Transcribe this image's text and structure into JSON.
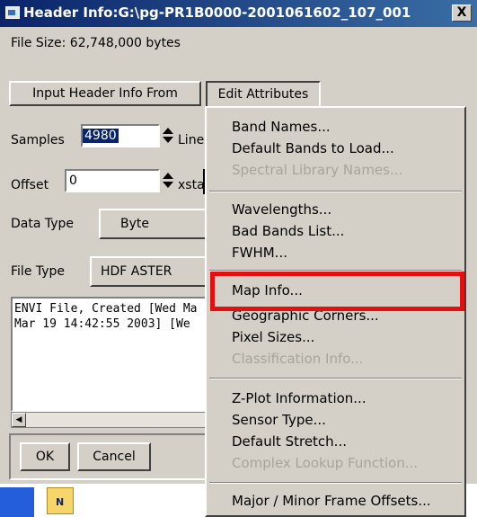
{
  "window": {
    "title": "Header Info:G:\\pg-PR1B0000-2001061602_107_001",
    "close_glyph": "X"
  },
  "file_size": "File Size: 62,748,000 bytes",
  "buttons": {
    "input_header": "Input Header Info From",
    "edit_attributes": "Edit Attributes",
    "ok": "OK",
    "cancel": "Cancel"
  },
  "fields": {
    "samples_label": "Samples",
    "samples_value": "4980",
    "lines_label": "Line",
    "offset_label": "Offset",
    "offset_value": "0",
    "xstart_label": "xstart",
    "data_type_label": "Data Type",
    "data_type_value": "Byte",
    "file_type_label": "File Type",
    "file_type_value": "HDF ASTER"
  },
  "description": {
    "line1": "ENVI File, Created [Wed Ma",
    "line2": "Mar 19 14:42:55 2003] [We"
  },
  "menu": {
    "groups": [
      [
        {
          "label": "Band Names...",
          "enabled": true
        },
        {
          "label": "Default Bands to Load...",
          "enabled": true
        },
        {
          "label": "Spectral Library Names...",
          "enabled": false
        }
      ],
      [
        {
          "label": "Wavelengths...",
          "enabled": true
        },
        {
          "label": "Bad Bands List...",
          "enabled": true
        },
        {
          "label": "FWHM...",
          "enabled": true
        }
      ],
      [
        {
          "label": "Map Info...",
          "enabled": true
        },
        {
          "label": "Geographic Corners...",
          "enabled": true
        },
        {
          "label": "Pixel Sizes...",
          "enabled": true
        },
        {
          "label": "Classification Info...",
          "enabled": false
        }
      ],
      [
        {
          "label": "Z-Plot Information...",
          "enabled": true
        },
        {
          "label": "Sensor Type...",
          "enabled": true
        },
        {
          "label": "Default Stretch...",
          "enabled": true
        },
        {
          "label": "Complex Lookup Function...",
          "enabled": false
        }
      ],
      [
        {
          "label": "Major / Minor Frame Offsets...",
          "enabled": true
        }
      ]
    ]
  },
  "taskbar": {
    "folder_glyph": "N"
  },
  "colors": {
    "highlight_box": "#e31010",
    "title_bar": "#0a246a"
  }
}
